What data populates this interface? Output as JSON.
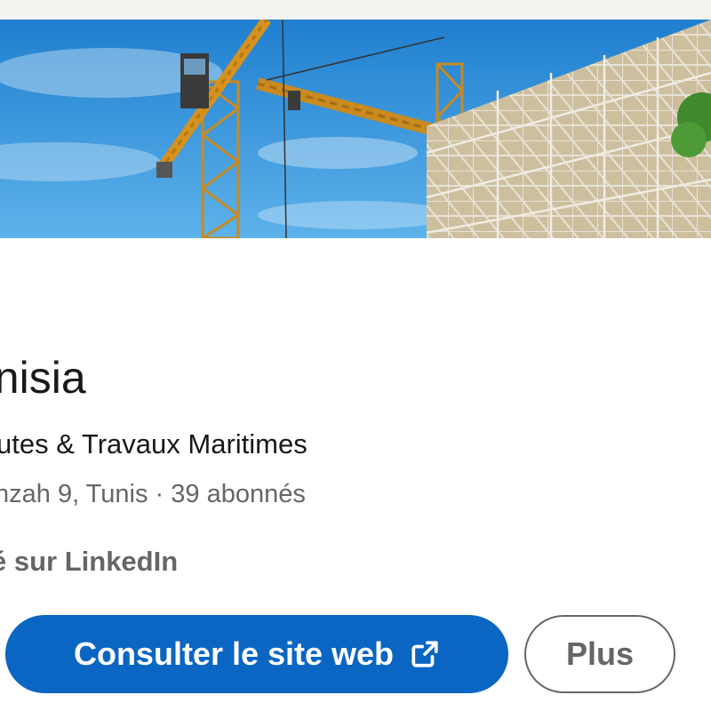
{
  "banner": {
    "image": "construction-site-cranes-scaffolding",
    "sky_color": "#2f8fd6"
  },
  "company": {
    "name": "unisia",
    "tagline": "utes & Travaux Maritimes",
    "location": "nzah 9, Tunis",
    "separator": " · ",
    "followers": "39 abonnés",
    "verified_text": "é sur LinkedIn"
  },
  "actions": {
    "website_label": "Consulter le site web",
    "website_icon": "external-link-icon",
    "more_label": "Plus"
  },
  "colors": {
    "primary": "#0a66c2",
    "text": "#191919",
    "muted": "#666666",
    "page_bg": "#f3f2ef"
  }
}
